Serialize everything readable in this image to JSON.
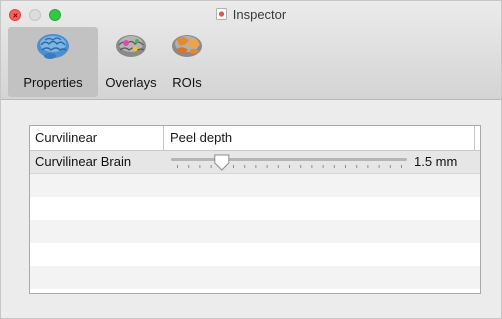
{
  "window": {
    "title": "Inspector"
  },
  "toolbar": {
    "tabs": [
      {
        "label": "Properties",
        "icon": "brain-surface-icon",
        "selected": true
      },
      {
        "label": "Overlays",
        "icon": "brain-overlay-icon",
        "selected": false
      },
      {
        "label": "ROIs",
        "icon": "brain-roi-icon",
        "selected": false
      }
    ]
  },
  "table": {
    "columns": [
      "Curvilinear",
      "Peel depth"
    ],
    "rows": [
      {
        "name": "Curvilinear Brain",
        "peel_depth_value": "1.5 mm",
        "slider_fraction": 0.2
      }
    ],
    "empty_row_count": 6
  },
  "colors": {
    "close": "#fc5f57",
    "zoom": "#33c748",
    "selected_tab": "#c2c2c2",
    "brain_blue": "#4a8fd0",
    "brain_orange": "#e58a2e"
  }
}
